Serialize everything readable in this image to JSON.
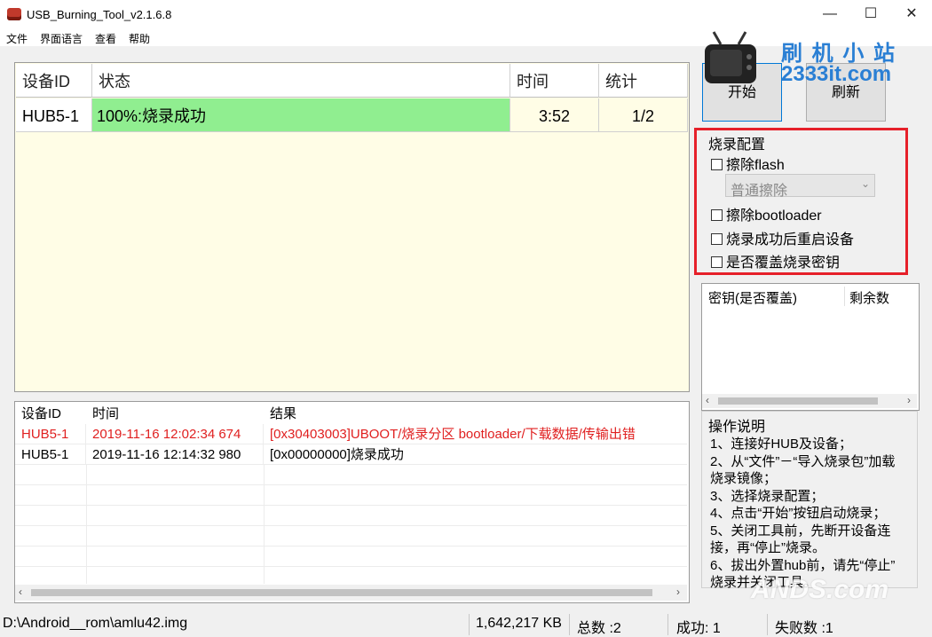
{
  "window": {
    "title": "USB_Burning_Tool_v2.1.6.8",
    "minimize": "—",
    "maximize": "☐",
    "close": "✕"
  },
  "menu": [
    "文件",
    "界面语言",
    "查看",
    "帮助"
  ],
  "watermark": {
    "line1": "刷 机 小 站",
    "line2": "2333it.com",
    "bottom": "ANDS.com"
  },
  "main_table": {
    "headers": {
      "device_id": "设备ID",
      "status": "状态",
      "time": "时间",
      "stats": "统计"
    },
    "rows": [
      {
        "device_id": "HUB5-1",
        "status": "100%:烧录成功",
        "time": "3:52",
        "stats": "1/2",
        "progress": 1.0
      }
    ]
  },
  "buttons": {
    "start": "开始",
    "refresh": "刷新"
  },
  "config": {
    "title": "烧录配置",
    "erase_flash": "擦除flash",
    "erase_mode": "普通擦除",
    "erase_bootloader": "擦除bootloader",
    "reboot_after": "烧录成功后重启设备",
    "overwrite_key": "是否覆盖烧录密钥"
  },
  "key_list": {
    "col1": "密钥(是否覆盖)",
    "col2": "剩余数"
  },
  "instructions": {
    "title": "操作说明",
    "lines": [
      "1、连接好HUB及设备；",
      "2、从“文件”－“导入烧录包”加载",
      "烧录镜像；",
      "3、选择烧录配置；",
      "4、点击“开始”按钮启动烧录；",
      "5、关闭工具前，先断开设备连",
      "接，再“停止”烧录。",
      "6、拔出外置hub前，请先“停止”",
      "烧录并关闭工具。"
    ]
  },
  "log": {
    "headers": {
      "device_id": "设备ID",
      "time": "时间",
      "result": "结果"
    },
    "rows": [
      {
        "device_id": "HUB5-1",
        "time": "2019-11-16 12:02:34 674",
        "result": "[0x30403003]UBOOT/烧录分区 bootloader/下载数据/传输出错",
        "error": true
      },
      {
        "device_id": "HUB5-1",
        "time": "2019-11-16 12:14:32 980",
        "result": "[0x00000000]烧录成功",
        "error": false
      }
    ]
  },
  "statusbar": {
    "path": "D:\\Android__rom\\amlu42.img",
    "size": "1,642,217 KB",
    "total": "总数 :2",
    "success": "成功:  1",
    "failed": "失败数 :1"
  },
  "colors": {
    "progress_green": "#90ee90",
    "grid_bg": "#fffde6",
    "error_red": "#e02020",
    "config_border": "#e6202a",
    "watermark_blue": "#2a7fd4"
  }
}
